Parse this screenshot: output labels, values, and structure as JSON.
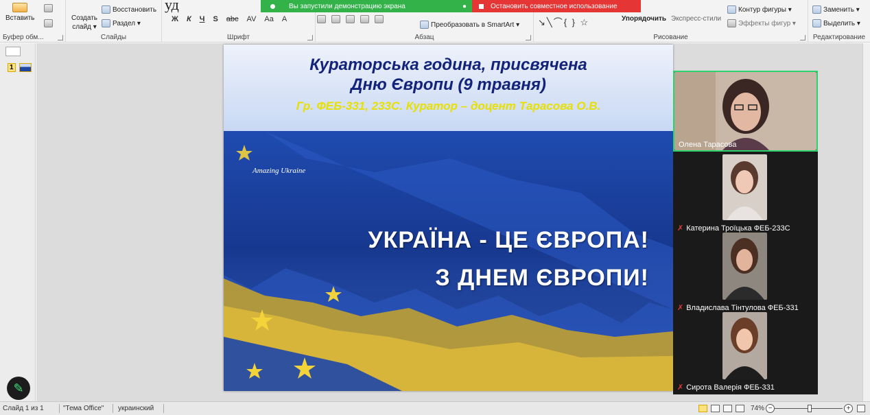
{
  "overline": "уд",
  "share": {
    "started_text": "Вы запустили демонстрацию экрана",
    "stop_text": "Остановить совместное использование"
  },
  "ribbon": {
    "clipboard": {
      "paste": "Вставить",
      "label": "Буфер обм..."
    },
    "slides": {
      "new_slide_1": "Создать",
      "new_slide_2": "слайд ▾",
      "restore": "Восстановить",
      "section": "Раздел ▾",
      "label": "Слайды"
    },
    "font": {
      "label": "Шрифт",
      "buttons": [
        "Ж",
        "К",
        "Ч",
        "S",
        "abc",
        "AV",
        "Aa",
        "A"
      ]
    },
    "paragraph": {
      "label": "Абзац",
      "smartart": "Преобразовать в SmartArt ▾"
    },
    "drawing": {
      "arrange": "Упорядочить",
      "quick_styles": "Экспресс-стили",
      "shape_outline": "Контур фигуры ▾",
      "shape_effects": "Эффекты фигур ▾",
      "label": "Рисование"
    },
    "editing": {
      "replace": "Заменить ▾",
      "select": "Выделить ▾",
      "label": "Редактирование"
    }
  },
  "thumbnails": {
    "slide_number": "1"
  },
  "slide": {
    "title_line1": "Кураторська година, присвячена",
    "title_line2": "Дню Європи (9 травня)",
    "subtitle": "Гр. ФЕБ-331, 233С.  Куратор – доцент Тарасова О.В.",
    "image_caption": "Amazing Ukraine",
    "slogan_line1": "УКРАЇНА - ЦЕ ЄВРОПА!",
    "slogan_line2": "З ДНЕМ ЄВРОПИ!"
  },
  "participants": [
    {
      "name": "Олена Тарасова",
      "muted": false,
      "active": true
    },
    {
      "name": "Катерина Троїцька ФЕБ-233С",
      "muted": true,
      "active": false
    },
    {
      "name": "Владислава Тінтулова ФЕБ-331",
      "muted": true,
      "active": false
    },
    {
      "name": "Сирота Валерія ФЕБ-331",
      "muted": true,
      "active": false
    }
  ],
  "statusbar": {
    "slide_of": "Слайд 1 из 1",
    "theme": "\"Тема Office\"",
    "language": "украинский",
    "zoom": "74%"
  },
  "colors": {
    "share_green": "#33b24a",
    "share_red": "#e63535",
    "active_speaker": "#2bd36d",
    "slide_title": "#13237a",
    "slide_subtitle": "#e8e000"
  }
}
